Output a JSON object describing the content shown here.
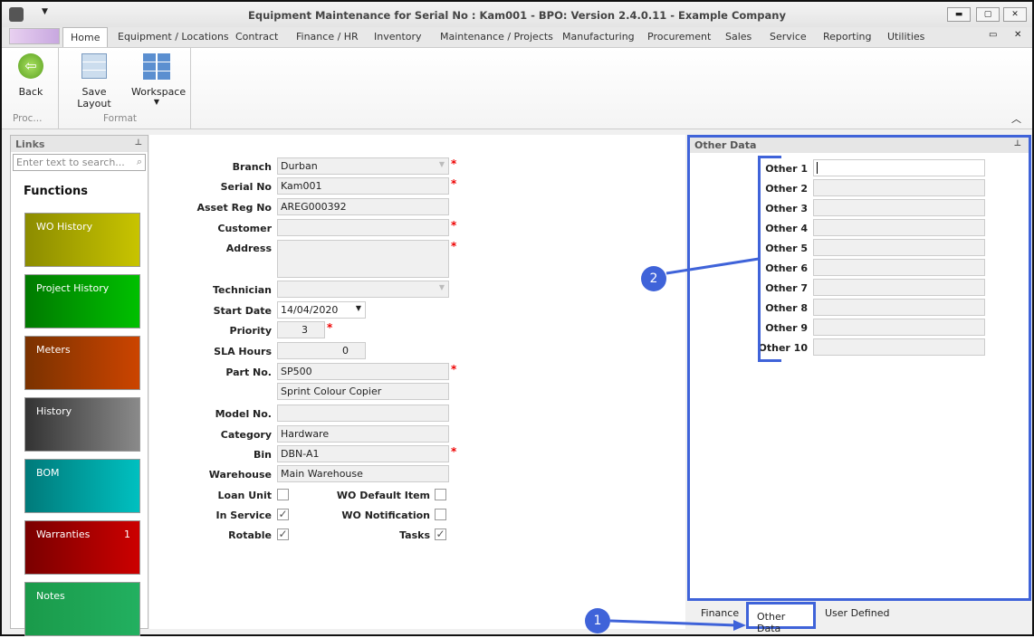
{
  "window": {
    "title": "Equipment Maintenance for Serial No : Kam001 - BPO: Version 2.4.0.11 - Example Company"
  },
  "menu_tabs": [
    "Home",
    "Equipment / Locations",
    "Contract",
    "Finance / HR",
    "Inventory",
    "Maintenance / Projects",
    "Manufacturing",
    "Procurement",
    "Sales",
    "Service",
    "Reporting",
    "Utilities"
  ],
  "ribbon": {
    "back": "Back",
    "save_layout": "Save Layout",
    "workspace": "Workspace",
    "group_process": "Proc...",
    "group_format": "Format"
  },
  "links": {
    "title": "Links",
    "search_placeholder": "Enter text to search...",
    "functions": "Functions",
    "tiles": [
      {
        "label": "WO History",
        "badge": ""
      },
      {
        "label": "Project History",
        "badge": ""
      },
      {
        "label": "Meters",
        "badge": ""
      },
      {
        "label": "History",
        "badge": ""
      },
      {
        "label": "BOM",
        "badge": ""
      },
      {
        "label": "Warranties",
        "badge": "1"
      },
      {
        "label": "Notes",
        "badge": ""
      }
    ]
  },
  "form": {
    "branch": {
      "label": "Branch",
      "value": "Durban"
    },
    "serial": {
      "label": "Serial No",
      "value": "Kam001"
    },
    "asset": {
      "label": "Asset Reg No",
      "value": "AREG000392"
    },
    "customer": {
      "label": "Customer",
      "value": ""
    },
    "address": {
      "label": "Address",
      "value": ""
    },
    "technician": {
      "label": "Technician",
      "value": ""
    },
    "start_date": {
      "label": "Start Date",
      "value": "14/04/2020"
    },
    "priority": {
      "label": "Priority",
      "value": "3"
    },
    "sla": {
      "label": "SLA Hours",
      "value": "0"
    },
    "part": {
      "label": "Part No.",
      "value": "SP500",
      "description": "Sprint Colour Copier"
    },
    "model": {
      "label": "Model No.",
      "value": ""
    },
    "category": {
      "label": "Category",
      "value": "Hardware"
    },
    "bin": {
      "label": "Bin",
      "value": "DBN-A1"
    },
    "warehouse": {
      "label": "Warehouse",
      "value": "Main Warehouse"
    },
    "loan_unit": {
      "label": "Loan Unit",
      "checked": false
    },
    "in_service": {
      "label": "In Service",
      "checked": true
    },
    "rotable": {
      "label": "Rotable",
      "checked": true
    },
    "wo_default": {
      "label": "WO Default Item",
      "checked": false
    },
    "wo_notification": {
      "label": "WO Notification",
      "checked": false
    },
    "tasks": {
      "label": "Tasks",
      "checked": true
    }
  },
  "other_data": {
    "title": "Other Data",
    "fields": [
      "Other 1",
      "Other 2",
      "Other 3",
      "Other 4",
      "Other 5",
      "Other 6",
      "Other 7",
      "Other 8",
      "Other 9",
      "Other 10"
    ]
  },
  "bottom_tabs": [
    "Finance",
    "Other Data",
    "User Defined"
  ],
  "annotations": [
    "1",
    "2"
  ],
  "colors": {
    "annotation": "#3f63d9",
    "required": "#e00000"
  }
}
